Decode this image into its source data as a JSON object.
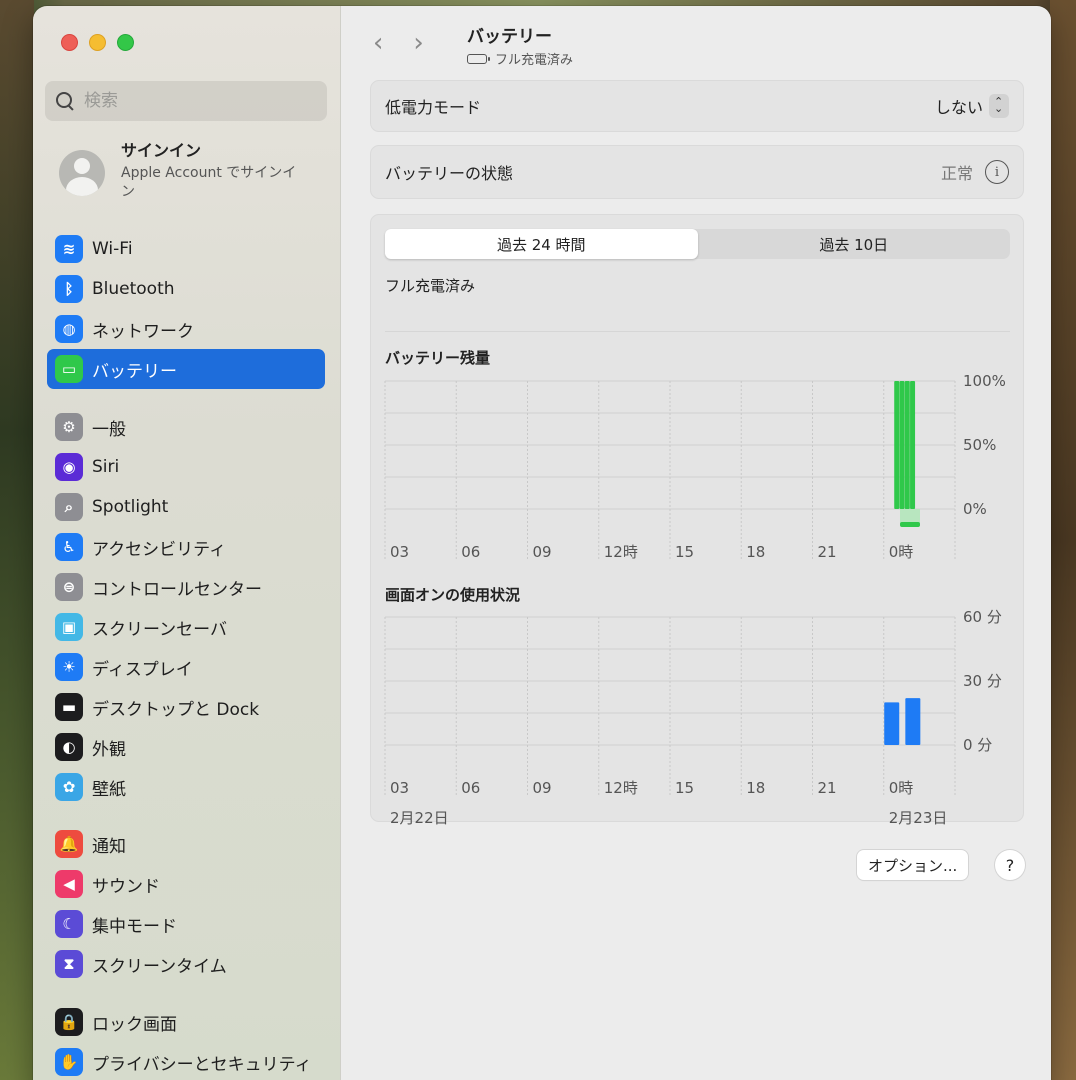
{
  "window": {
    "title": "バッテリー",
    "subtitle": "フル充電済み"
  },
  "search": {
    "placeholder": "検索"
  },
  "account": {
    "title": "サインイン",
    "subtitle": "Apple Account でサインイン"
  },
  "sidebar": {
    "group1": [
      {
        "label": "Wi-Fi",
        "icon": "wifi-icon",
        "color": "#1e7bf5",
        "glyph": "≋"
      },
      {
        "label": "Bluetooth",
        "icon": "bluetooth-icon",
        "color": "#1e7bf5",
        "glyph": "ᛒ"
      },
      {
        "label": "ネットワーク",
        "icon": "globe-icon",
        "color": "#1e7bf5",
        "glyph": "◍"
      },
      {
        "label": "バッテリー",
        "icon": "battery-icon",
        "color": "#2fc84a",
        "glyph": "▭",
        "active": true
      }
    ],
    "group2": [
      {
        "label": "一般",
        "icon": "gear-icon",
        "color": "#8e8e93",
        "glyph": "⚙"
      },
      {
        "label": "Siri",
        "icon": "siri-icon",
        "color": "#5b2bd6",
        "glyph": "◉"
      },
      {
        "label": "Spotlight",
        "icon": "spotlight-icon",
        "color": "#8e8e93",
        "glyph": "⌕"
      },
      {
        "label": "アクセシビリティ",
        "icon": "accessibility-icon",
        "color": "#1e7bf5",
        "glyph": "♿"
      },
      {
        "label": "コントロールセンター",
        "icon": "control-center-icon",
        "color": "#8e8e93",
        "glyph": "⊜"
      },
      {
        "label": "スクリーンセーバ",
        "icon": "screensaver-icon",
        "color": "#43b8e6",
        "glyph": "▣"
      },
      {
        "label": "ディスプレイ",
        "icon": "display-icon",
        "color": "#1e7bf5",
        "glyph": "☀"
      },
      {
        "label": "デスクトップと Dock",
        "icon": "dock-icon",
        "color": "#1c1c1e",
        "glyph": "▬"
      },
      {
        "label": "外観",
        "icon": "appearance-icon",
        "color": "#1c1c1e",
        "glyph": "◐"
      },
      {
        "label": "壁紙",
        "icon": "wallpaper-icon",
        "color": "#3aa6e6",
        "glyph": "✿"
      }
    ],
    "group3": [
      {
        "label": "通知",
        "icon": "notification-icon",
        "color": "#ee4b3f",
        "glyph": "🔔"
      },
      {
        "label": "サウンド",
        "icon": "sound-icon",
        "color": "#ee3a6a",
        "glyph": "◀"
      },
      {
        "label": "集中モード",
        "icon": "moon-icon",
        "color": "#5b4bd6",
        "glyph": "☾"
      },
      {
        "label": "スクリーンタイム",
        "icon": "hourglass-icon",
        "color": "#5b4bd6",
        "glyph": "⧗"
      }
    ],
    "group4": [
      {
        "label": "ロック画面",
        "icon": "lock-icon",
        "color": "#1c1c1e",
        "glyph": "🔒"
      },
      {
        "label": "プライバシーとセキュリティ",
        "icon": "hand-icon",
        "color": "#1e7bf5",
        "glyph": "✋"
      }
    ]
  },
  "main": {
    "low_power": {
      "label": "低電力モード",
      "value": "しない"
    },
    "battery_health": {
      "label": "バッテリーの状態",
      "value": "正常"
    },
    "tabs": [
      {
        "label": "過去 24 時間",
        "selected": true
      },
      {
        "label": "過去 10日",
        "selected": false
      }
    ],
    "charge_status": "フル充電済み",
    "options_button": "オプション...",
    "help_button": "?"
  },
  "chart_data": [
    {
      "type": "bar",
      "title": "バッテリー残量",
      "x_ticks": [
        "03",
        "06",
        "09",
        "12時",
        "15",
        "18",
        "21",
        "0時"
      ],
      "y_ticks": [
        "100%",
        "50%",
        "0%"
      ],
      "ylim": [
        0,
        100
      ],
      "series": [
        {
          "values": [
            100,
            100,
            100,
            100
          ]
        }
      ],
      "bar_hours": [
        24.5,
        24.75,
        25.0,
        25.25
      ],
      "color": "#2fc84a"
    },
    {
      "type": "bar",
      "title": "画面オンの使用状況",
      "x_ticks": [
        "03",
        "06",
        "09",
        "12時",
        "15",
        "18",
        "21",
        "0時"
      ],
      "y_ticks": [
        "60 分",
        "30 分",
        "0 分"
      ],
      "ylim": [
        0,
        60
      ],
      "series": [
        {
          "values": [
            20,
            22
          ]
        }
      ],
      "bar_hours": [
        24.5,
        25.5
      ],
      "color": "#1e7bf5",
      "date_labels": [
        "2月22日",
        "2月23日"
      ]
    }
  ]
}
